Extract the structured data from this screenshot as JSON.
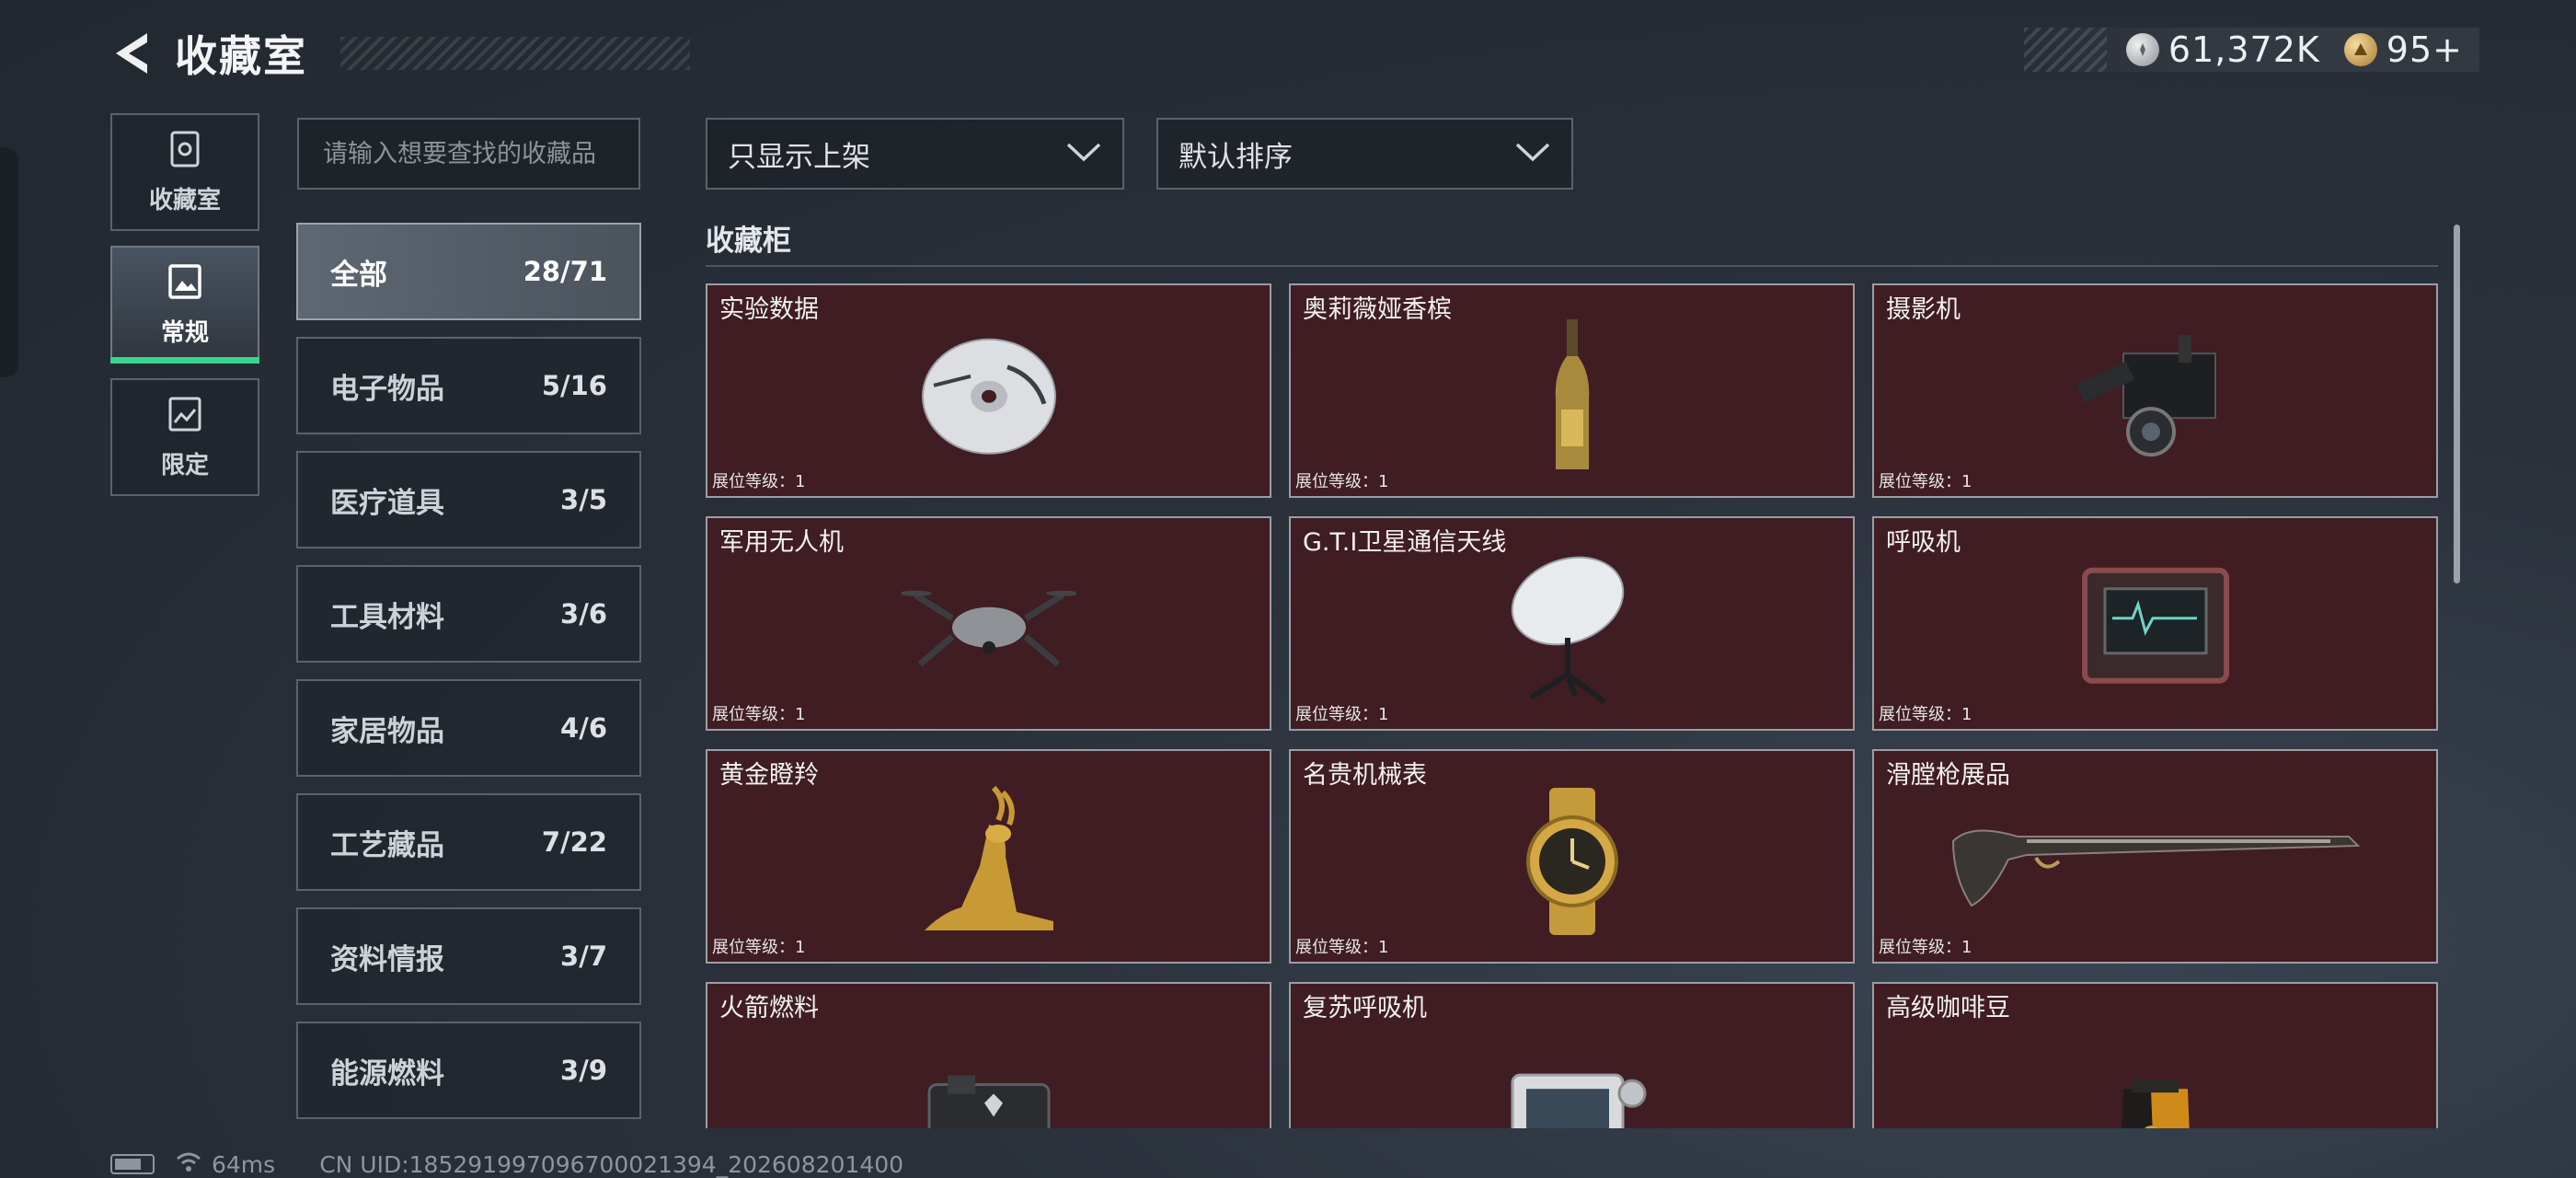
{
  "header": {
    "title": "收藏室",
    "currency_silver": "61,372K",
    "currency_gold": "95+"
  },
  "sidenav": {
    "items": [
      {
        "label": "收藏室",
        "icon": "vault-icon",
        "active": false
      },
      {
        "label": "常规",
        "icon": "picture-icon",
        "active": true
      },
      {
        "label": "限定",
        "icon": "limited-picture-icon",
        "active": false
      }
    ]
  },
  "search": {
    "placeholder": "请输入想要查找的收藏品"
  },
  "categories": [
    {
      "name": "全部",
      "count": "28/71",
      "active": true
    },
    {
      "name": "电子物品",
      "count": "5/16"
    },
    {
      "name": "医疗道具",
      "count": "3/5"
    },
    {
      "name": "工具材料",
      "count": "3/6"
    },
    {
      "name": "家居物品",
      "count": "4/6"
    },
    {
      "name": "工艺藏品",
      "count": "7/22"
    },
    {
      "name": "资料情报",
      "count": "3/7"
    },
    {
      "name": "能源燃料",
      "count": "3/9"
    }
  ],
  "filters": {
    "display": "只显示上架",
    "sort": "默认排序"
  },
  "section_title": "收藏柜",
  "items": [
    {
      "name": "实验数据",
      "level": "展位等级：1",
      "icon": "disc-icon"
    },
    {
      "name": "奥莉薇娅香槟",
      "level": "展位等级：1",
      "icon": "champagne-bottle-icon"
    },
    {
      "name": "摄影机",
      "level": "展位等级：1",
      "icon": "video-camera-icon"
    },
    {
      "name": "军用无人机",
      "level": "展位等级：1",
      "icon": "drone-icon"
    },
    {
      "name": "G.T.I卫星通信天线",
      "level": "展位等级：1",
      "icon": "satellite-dish-icon"
    },
    {
      "name": "呼吸机",
      "level": "展位等级：1",
      "icon": "ventilator-monitor-icon"
    },
    {
      "name": "黄金瞪羚",
      "level": "展位等级：1",
      "icon": "golden-gazelle-icon"
    },
    {
      "name": "名贵机械表",
      "level": "展位等级：1",
      "icon": "wristwatch-icon"
    },
    {
      "name": "滑膛枪展品",
      "level": "展位等级：1",
      "icon": "musket-icon"
    },
    {
      "name": "火箭燃料",
      "level": "",
      "icon": "fuel-canister-icon"
    },
    {
      "name": "复苏呼吸机",
      "level": "",
      "icon": "resuscitator-icon"
    },
    {
      "name": "高级咖啡豆",
      "level": "",
      "icon": "coffee-bag-icon"
    }
  ],
  "status": {
    "ping": "64ms",
    "uid": "CN UID:18529199709670002139​4_202608201400"
  }
}
